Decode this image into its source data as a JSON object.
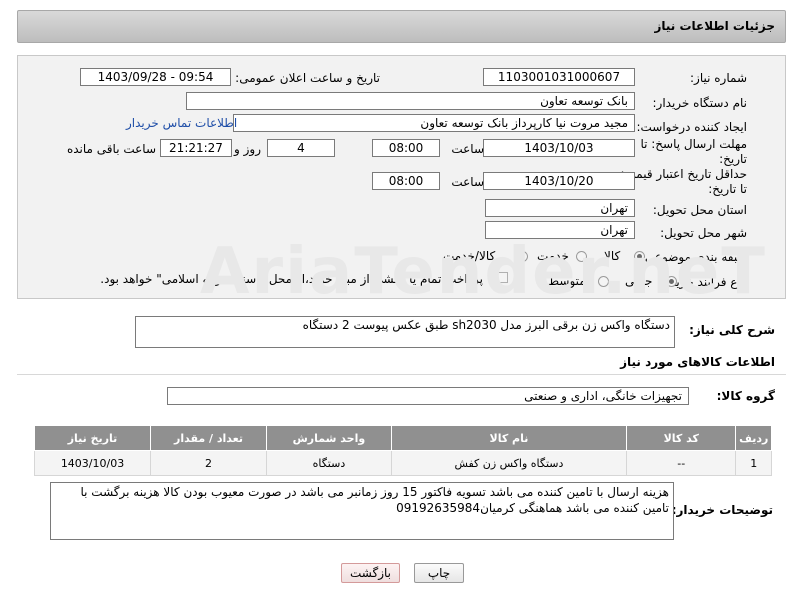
{
  "header": {
    "title": "جزئیات اطلاعات نیاز"
  },
  "form": {
    "need_number": {
      "label": "شماره نیاز:",
      "value": "1103001031000607"
    },
    "announce_datetime": {
      "label": "تاریخ و ساعت اعلان عمومی:",
      "value": "1403/09/28 - 09:54"
    },
    "buyer_org": {
      "label": "نام دستگاه خریدار:",
      "value": "بانک توسعه تعاون"
    },
    "requester": {
      "label": "ایجاد کننده درخواست:",
      "value": "مجید مروت نیا کارپرداز بانک توسعه تعاون"
    },
    "contact_link": "اطلاعات تماس خریدار",
    "reply_deadline": {
      "label": "مهلت ارسال پاسخ: تا تاریخ:",
      "date": "1403/10/03",
      "time_label": "ساعت",
      "time": "08:00",
      "days": "4",
      "days_label": "روز و",
      "remaining": "21:21:27",
      "remaining_label": "ساعت باقی مانده"
    },
    "price_validity": {
      "label": "حداقل تاریخ اعتبار قیمت: تا تاریخ:",
      "date": "1403/10/20",
      "time_label": "ساعت",
      "time": "08:00"
    },
    "delivery_province": {
      "label": "استان محل تحویل:",
      "value": "تهران"
    },
    "delivery_city": {
      "label": "شهر محل تحویل:",
      "value": "تهران"
    },
    "category": {
      "label": "طبقه بندی موضوعی:",
      "options": [
        "کالا",
        "خدمت",
        "کالا/خدمت"
      ],
      "selected": "کالا"
    },
    "purchase_type": {
      "label": "نوع فرآیند خرید :",
      "options": [
        "جزیی",
        "متوسط"
      ],
      "selected": "جزیی",
      "payment_note": "پرداخت تمام یا بخشی از مبلغ خرید،از محل \"اسناد خزانه اسلامی\" خواهد بود."
    }
  },
  "summary": {
    "label": "شرح کلی نیاز:",
    "value": "دستگاه واکس زن برقی البرز مدل sh2030 طبق عکس پیوست 2 دستگاه"
  },
  "goods_section": {
    "title": "اطلاعات کالاهای مورد نیاز",
    "group_label": "گروه کالا:",
    "group_value": "تجهیزات خانگی، اداری و صنعتی",
    "table": {
      "headers": [
        "ردیف",
        "کد کالا",
        "نام کالا",
        "واحد شمارش",
        "تعداد / مقدار",
        "تاریخ نیاز"
      ],
      "rows": [
        [
          "1",
          "--",
          "دستگاه واکس زن کفش",
          "دستگاه",
          "2",
          "1403/10/03"
        ]
      ]
    }
  },
  "buyer_notes": {
    "label": "توضیحات خریدار:",
    "value": "هزینه ارسال با تامین کننده می باشد تسویه فاکتور 15 روز زمانبر می باشد در صورت معیوب بودن کالا هزینه برگشت با تامین کننده می باشد هماهنگی کرمیان09192635984"
  },
  "buttons": {
    "print": "چاپ",
    "back": "بازگشت"
  }
}
